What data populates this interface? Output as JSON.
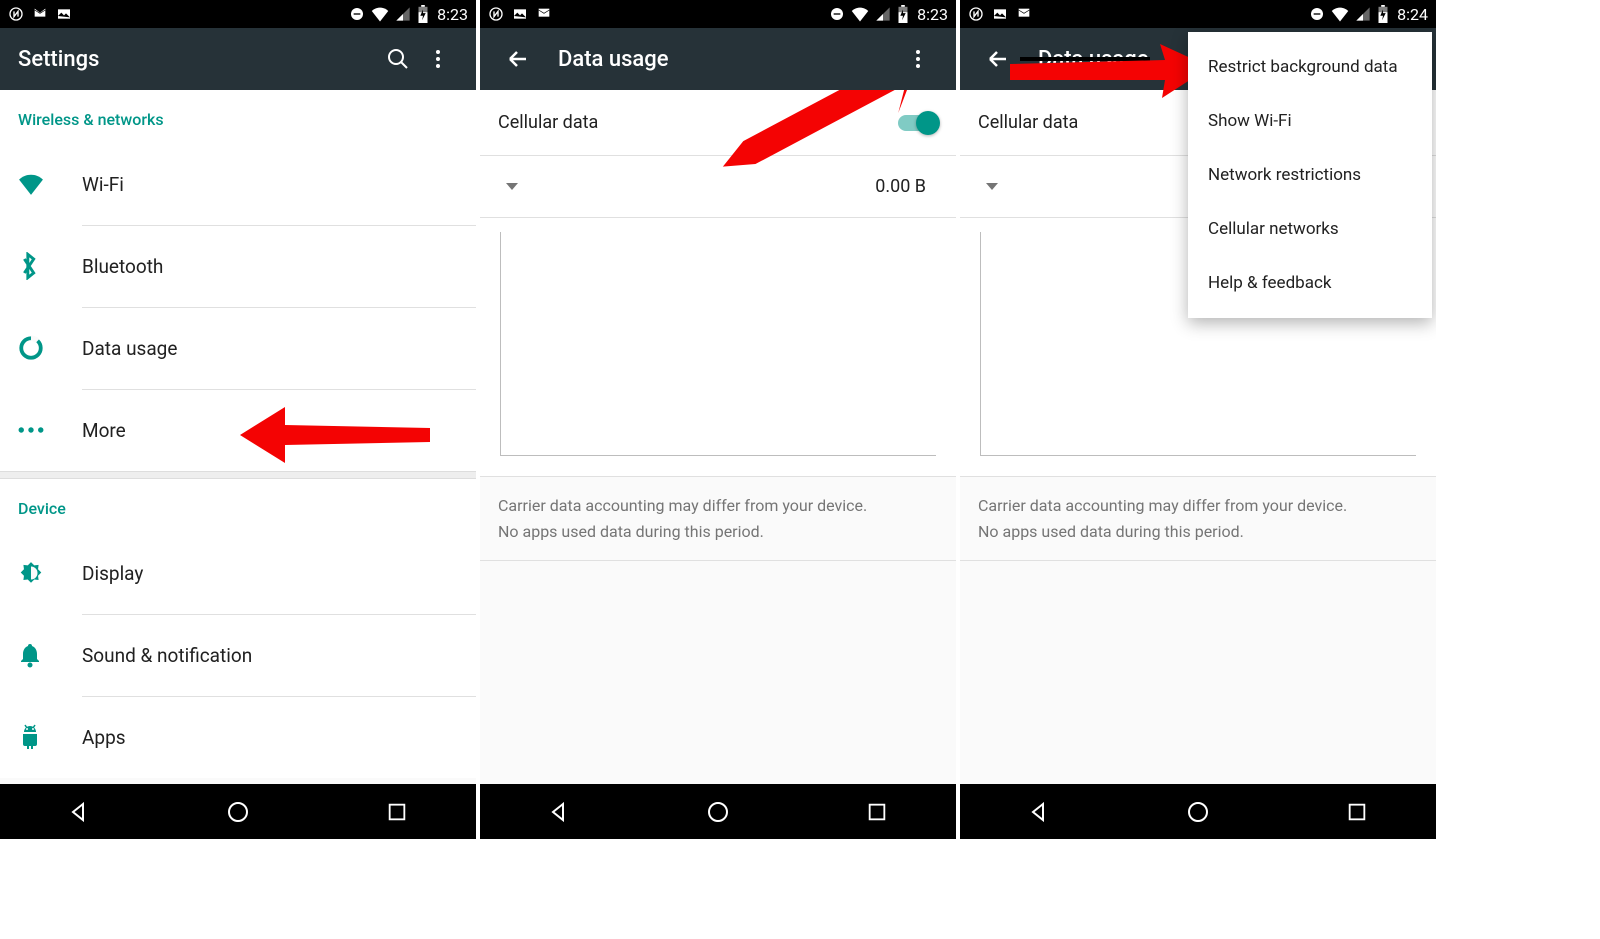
{
  "screen1": {
    "status_time": "8:23",
    "title": "Settings",
    "section_wireless": "Wireless & networks",
    "items_wireless": [
      "Wi-Fi",
      "Bluetooth",
      "Data usage",
      "More"
    ],
    "section_device": "Device",
    "items_device": [
      "Display",
      "Sound & notification",
      "Apps"
    ]
  },
  "screen2": {
    "status_time": "8:23",
    "title": "Data usage",
    "cellular_label": "Cellular data",
    "data_value": "0.00 B",
    "footer_line1": "Carrier data accounting may differ from your device.",
    "footer_line2": "No apps used data during this period."
  },
  "screen3": {
    "status_time": "8:24",
    "title": "Data usage",
    "cellular_label": "Cellular data",
    "menu_items": [
      "Restrict background data",
      "Show Wi-Fi",
      "Network restrictions",
      "Cellular networks",
      "Help & feedback"
    ],
    "footer_line1": "Carrier data accounting may differ from your device.",
    "footer_line2": "No apps used data during this period."
  },
  "colors": {
    "accent": "#009688",
    "app_bar": "#263238",
    "arrow": "#F40303"
  }
}
